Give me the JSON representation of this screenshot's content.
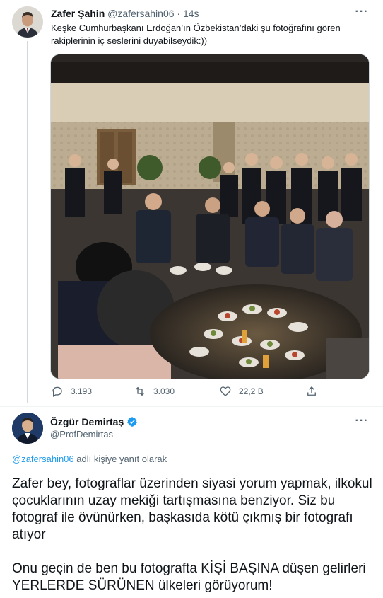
{
  "tweet1": {
    "author_name": "Zafer Şahin",
    "author_handle": "@zafersahin06",
    "separator": "·",
    "time": "14s",
    "text": "Keşke Cumhurbaşkanı Erdoğan’ın Özbekistan’daki şu fotoğrafını gören rakiplerinin iç seslerini duyabilseydik:))",
    "photo_icon": "photo-image",
    "metrics": {
      "replies": "3.193",
      "retweets": "3.030",
      "likes": "22,2 B"
    },
    "more_icon": "more-dots-icon"
  },
  "tweet2": {
    "author_name": "Özgür Demirtaş",
    "author_handle": "@ProfDemirtas",
    "verified": true,
    "replying_handle": "@zafersahin06",
    "replying_text": " adlı kişiye yanıt olarak",
    "paragraph1": "Zafer bey, fotograflar üzerinden siyasi yorum yapmak, ilkokul çocuklarının uzay mekiği tartışmasına benziyor. Siz bu fotograf ile övünürken, başkasıda kötü çıkmış bir fotografı atıyor",
    "paragraph2": "Onu geçin de ben bu fotografta KİŞİ BAŞINA düşen gelirleri YERLERDE SÜRÜNEN ülkeleri görüyorum!"
  },
  "colors": {
    "accent": "#1d9bf0",
    "text": "#0f1419",
    "muted": "#536471",
    "border": "#cfd9de"
  }
}
